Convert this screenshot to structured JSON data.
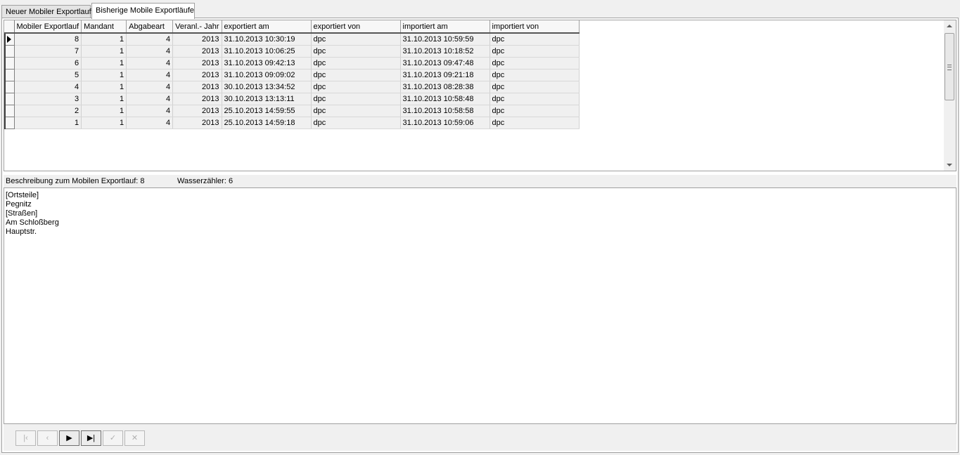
{
  "tabs": [
    {
      "label": "Neuer Mobiler Exportlauf",
      "active": false
    },
    {
      "label": "Bisherige Mobile Exportläufe",
      "active": true
    }
  ],
  "grid": {
    "columns": [
      "Mobiler Exportlauf",
      "Mandant",
      "Abgabeart",
      "Veranl.- Jahr",
      "exportiert am",
      "exportiert von",
      "importiert am",
      "importiert von"
    ],
    "rows": [
      [
        "8",
        "1",
        "4",
        "2013",
        "31.10.2013 10:30:19",
        "dpc",
        "31.10.2013 10:59:59",
        "dpc"
      ],
      [
        "7",
        "1",
        "4",
        "2013",
        "31.10.2013 10:06:25",
        "dpc",
        "31.10.2013 10:18:52",
        "dpc"
      ],
      [
        "6",
        "1",
        "4",
        "2013",
        "31.10.2013 09:42:13",
        "dpc",
        "31.10.2013 09:47:48",
        "dpc"
      ],
      [
        "5",
        "1",
        "4",
        "2013",
        "31.10.2013 09:09:02",
        "dpc",
        "31.10.2013 09:21:18",
        "dpc"
      ],
      [
        "4",
        "1",
        "4",
        "2013",
        "30.10.2013 13:34:52",
        "dpc",
        "31.10.2013 08:28:38",
        "dpc"
      ],
      [
        "3",
        "1",
        "4",
        "2013",
        "30.10.2013 13:13:11",
        "dpc",
        "31.10.2013 10:58:48",
        "dpc"
      ],
      [
        "2",
        "1",
        "4",
        "2013",
        "25.10.2013 14:59:55",
        "dpc",
        "31.10.2013 10:58:58",
        "dpc"
      ],
      [
        "1",
        "1",
        "4",
        "2013",
        "25.10.2013 14:59:18",
        "dpc",
        "31.10.2013 10:59:06",
        "dpc"
      ]
    ],
    "selected_row": 0
  },
  "description": {
    "label": "Beschreibung zum Mobilen Exportlauf: 8",
    "water_meters": "Wasserzähler: 6"
  },
  "details_text": "[Ortsteile]\nPegnitz\n[Straßen]\nAm Schloßberg\nHauptstr.",
  "navigator": {
    "buttons": [
      {
        "name": "first-record-button",
        "icon": "first-icon",
        "glyph": "|‹",
        "enabled": false
      },
      {
        "name": "prior-record-button",
        "icon": "prior-icon",
        "glyph": "‹",
        "enabled": false
      },
      {
        "name": "next-record-button",
        "icon": "next-icon",
        "glyph": "▶",
        "enabled": true
      },
      {
        "name": "last-record-button",
        "icon": "last-icon",
        "glyph": "▶|",
        "enabled": true
      },
      {
        "name": "post-record-button",
        "icon": "check-icon",
        "glyph": "✓",
        "enabled": false
      },
      {
        "name": "cancel-record-button",
        "icon": "cancel-icon",
        "glyph": "✕",
        "enabled": false
      }
    ]
  }
}
